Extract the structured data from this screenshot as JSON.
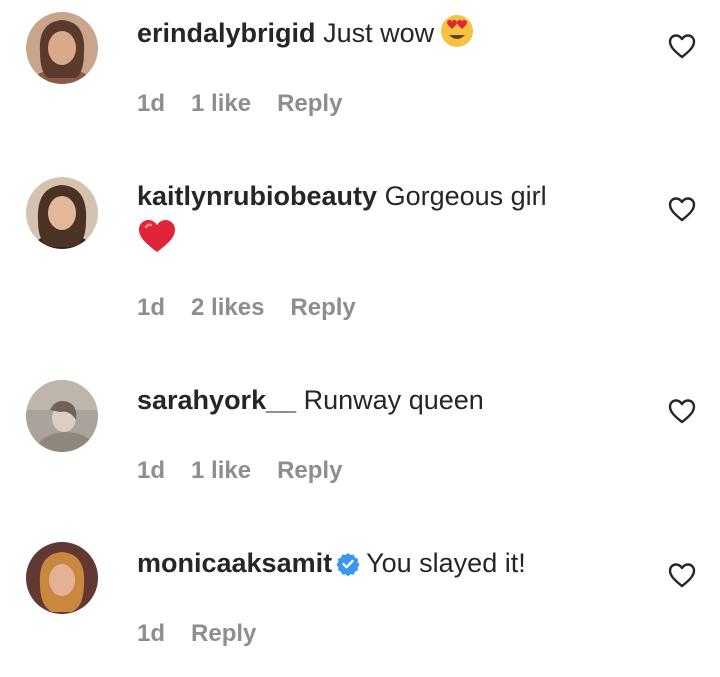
{
  "comments": [
    {
      "username": "erindalybrigid",
      "text": "Just wow",
      "emoji": "heart-eyes-emoji",
      "time": "1d",
      "likes": "1 like",
      "reply": "Reply"
    },
    {
      "username": "kaitlynrubiobeauty",
      "text": "Gorgeous girl",
      "emoji": "red-heart-emoji",
      "time": "1d",
      "likes": "2 likes",
      "reply": "Reply"
    },
    {
      "username": "sarahyork__",
      "text": "Runway queen",
      "time": "1d",
      "likes": "1 like",
      "reply": "Reply"
    },
    {
      "username": "monicaaksamit",
      "verified": true,
      "text": "You slayed it!",
      "time": "1d",
      "reply": "Reply"
    }
  ],
  "colors": {
    "text": "#262626",
    "meta": "#8e8e8e",
    "verified": "#3897f0",
    "heart_emoji": "#e0243a"
  }
}
